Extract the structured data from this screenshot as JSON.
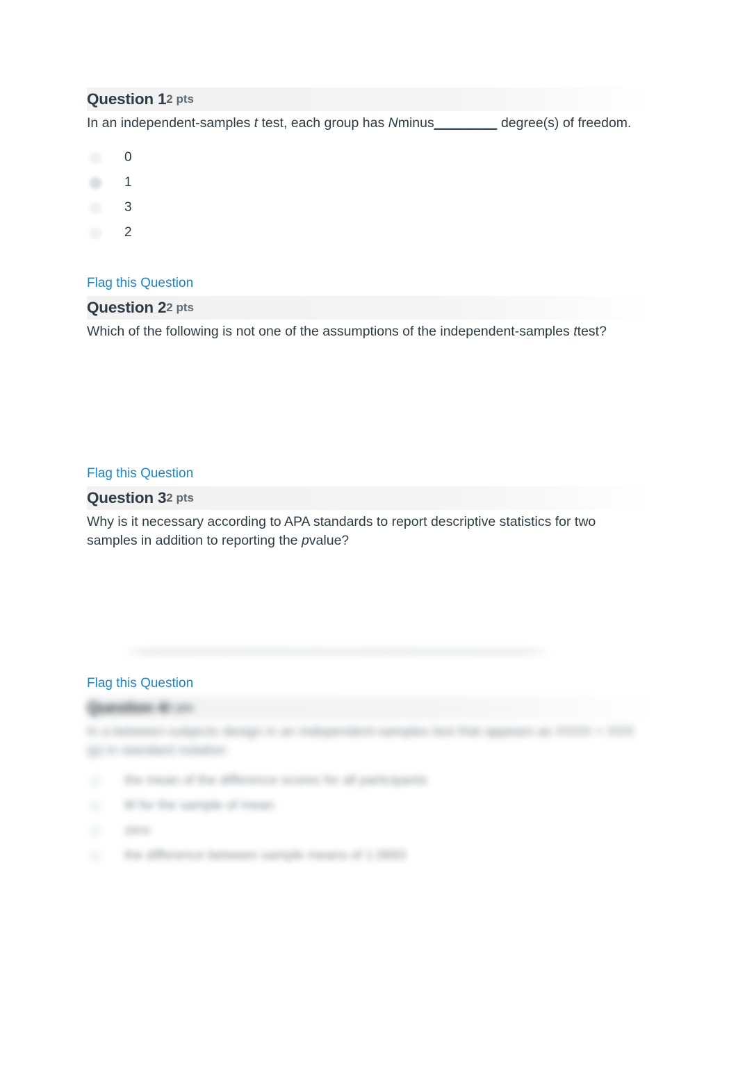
{
  "document": {
    "type": "online-quiz-printout",
    "link_color": "#1a86c8",
    "text_color": "#2d3b45",
    "header_band_color": "#f2f2f2"
  },
  "flag_link_label": "Flag this Question",
  "questions": [
    {
      "id": "q1",
      "title": "Question 1",
      "points": "2 pts",
      "legible": true,
      "text_parts": {
        "a": "In an independent-samples ",
        "italic1": "t",
        "b": " test, each group has ",
        "italic2": "N",
        "c": "minus",
        "blank": "________",
        "d": " degree(s) of freedom."
      },
      "plain_text": "In an independent-samples t test, each group has N minus________ degree(s) of freedom.",
      "options": [
        {
          "label": "0",
          "selected": false
        },
        {
          "label": "1",
          "selected": true
        },
        {
          "label": "3",
          "selected": false
        },
        {
          "label": "2",
          "selected": false
        }
      ]
    },
    {
      "id": "q2",
      "title": "Question 2",
      "points": "2 pts",
      "legible": true,
      "text_parts": {
        "a": "Which of the following is not one of the assumptions of the independent-samples ",
        "italic1": "t",
        "b": "test?"
      },
      "plain_text": "Which of the following is not one of the assumptions of the independent-samples t test?",
      "options": []
    },
    {
      "id": "q3",
      "title": "Question 3",
      "points": "2 pts",
      "legible": true,
      "text_parts": {
        "a": "Why is it necessary according to APA standards to report descriptive statistics for two samples in addition to reporting the ",
        "italic1": "p",
        "b": "value?"
      },
      "plain_text": "Why is it necessary according to APA standards to report descriptive statistics for two samples in addition to reporting the p value?",
      "options": []
    },
    {
      "id": "q4",
      "title": "Question 4",
      "points": "2 pts",
      "legible": false,
      "obscured_note": "Question 4 heading, prompt and answer options are blurred and unreadable in the source image.",
      "text_line_1": "In a between-subjects design in an independent-samples test that appears as XXXX = XXX (p) ",
      "text_line_2": "in standard notation",
      "options": [
        {
          "label": "the mean of the difference scores for all participants",
          "selected": false
        },
        {
          "label": "M for the sample of mean",
          "selected": false
        },
        {
          "label": "zero",
          "selected": false
        },
        {
          "label": "the difference between sample means of 1.0893",
          "selected": false
        }
      ]
    }
  ]
}
